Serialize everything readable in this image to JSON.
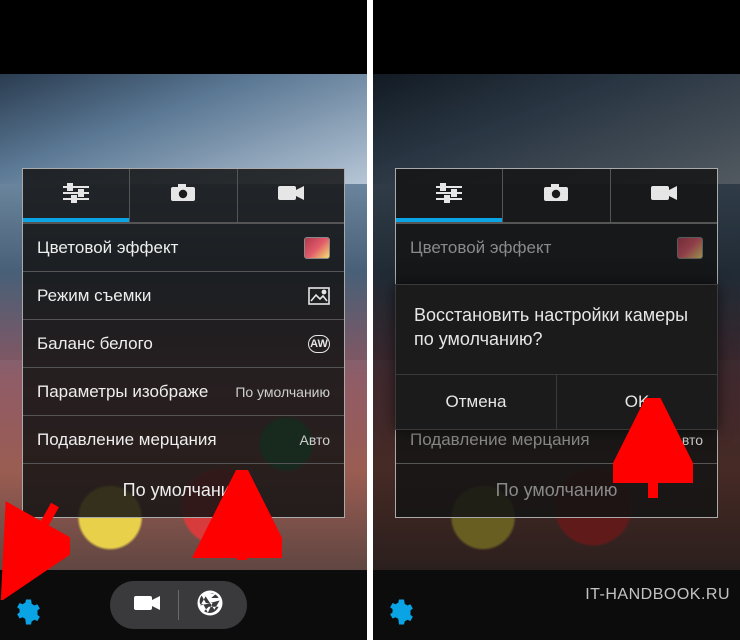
{
  "watermark": "IT-HANDBOOK.RU",
  "tabs": {
    "sliders": "sliders",
    "photo": "photo",
    "video": "video"
  },
  "settings": {
    "color_effect": {
      "label": "Цветовой эффект"
    },
    "shoot_mode": {
      "label": "Режим съемки"
    },
    "white_balance": {
      "label": "Баланс белого",
      "value_icon": "AW"
    },
    "image_params": {
      "label": "Параметры изображе",
      "value": "По умолчанию"
    },
    "flicker": {
      "label": "Подавление мерцания",
      "value": "Авто"
    },
    "reset": {
      "label": "По умолчанию"
    }
  },
  "dialog": {
    "message": "Восстановить настройки камеры по умолчанию?",
    "cancel": "Отмена",
    "ok": "OK"
  }
}
